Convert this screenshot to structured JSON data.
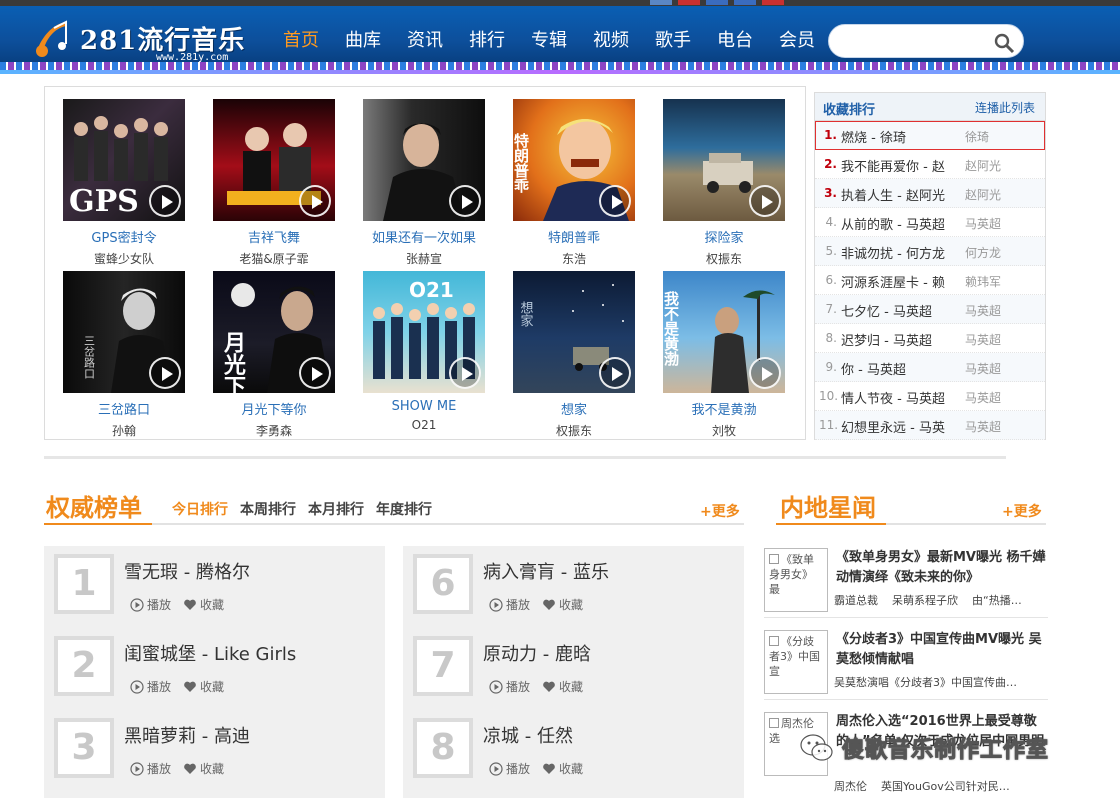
{
  "header": {
    "logo_name": "281流行音乐",
    "logo_url": "www.281y.com",
    "nav": [
      "首页",
      "曲库",
      "资讯",
      "排行",
      "专辑",
      "视频",
      "歌手",
      "电台",
      "会员"
    ],
    "active_nav": "首页",
    "search_placeholder": ""
  },
  "albums": [
    {
      "title": "GPS密封令",
      "singer": "蜜蜂少女队",
      "cover_text": "GPS"
    },
    {
      "title": "吉祥飞舞",
      "singer": "老猫&原子霏",
      "cover_text": ""
    },
    {
      "title": "如果还有一次如果",
      "singer": "张赫宣",
      "cover_text": ""
    },
    {
      "title": "特朗普乖",
      "singer": "东浩",
      "cover_text": "特朗普乖"
    },
    {
      "title": "探险家",
      "singer": "权振东",
      "cover_text": ""
    },
    {
      "title": "三岔路口",
      "singer": "孙翰",
      "cover_text": "三岔路口"
    },
    {
      "title": "月光下等你",
      "singer": "李勇森",
      "cover_text": "月光下"
    },
    {
      "title": "SHOW ME",
      "singer": "O21",
      "cover_text": "O21"
    },
    {
      "title": "想家",
      "singer": "权振东",
      "cover_text": "想家"
    },
    {
      "title": "我不是黄渤",
      "singer": "刘牧",
      "cover_text": "我不是黄渤"
    }
  ],
  "favorites": {
    "title": "收藏排行",
    "play_all": "连播此列表",
    "items": [
      {
        "n": "1.",
        "song": "燃烧 - 徐琦",
        "artist": "徐琦"
      },
      {
        "n": "2.",
        "song": "我不能再爱你 - 赵",
        "artist": "赵阿光"
      },
      {
        "n": "3.",
        "song": "执着人生 - 赵阿光",
        "artist": "赵阿光"
      },
      {
        "n": "4.",
        "song": "从前的歌 - 马英超",
        "artist": "马英超"
      },
      {
        "n": "5.",
        "song": "非诚勿扰 - 何方龙",
        "artist": "何方龙"
      },
      {
        "n": "6.",
        "song": "河源系涯屋卡 - 赖",
        "artist": "赖玮军"
      },
      {
        "n": "7.",
        "song": "七夕忆 - 马英超",
        "artist": "马英超"
      },
      {
        "n": "8.",
        "song": "迟梦归 - 马英超",
        "artist": "马英超"
      },
      {
        "n": "9.",
        "song": "你 - 马英超",
        "artist": "马英超"
      },
      {
        "n": "10.",
        "song": "情人节夜 - 马英超",
        "artist": "马英超"
      },
      {
        "n": "11.",
        "song": "幻想里永远 - 马英",
        "artist": "马英超"
      }
    ]
  },
  "charts": {
    "title": "权威榜单",
    "tabs": [
      "今日排行",
      "本周排行",
      "本月排行",
      "年度排行"
    ],
    "more": "+更多",
    "play_label": "播放",
    "fav_label": "收藏",
    "left": [
      {
        "num": "1",
        "song": "雪无瑕 - 腾格尔"
      },
      {
        "num": "2",
        "song": "闺蜜城堡 - Like Girls"
      },
      {
        "num": "3",
        "song": "黑暗萝莉 - 高迪"
      }
    ],
    "right": [
      {
        "num": "6",
        "song": "病入膏肓 - 蓝乐"
      },
      {
        "num": "7",
        "song": "原动力 - 鹿晗"
      },
      {
        "num": "8",
        "song": "凉城 - 任然"
      }
    ]
  },
  "news": {
    "title": "内地星闻",
    "more": "+更多",
    "items": [
      {
        "thumb": "《致单身男女》最",
        "headline": "《致单身男女》最新MV曝光 杨千嬅动情演绎《致未来的你》",
        "meta": [
          "霸道总裁",
          "呆萌系程子欣",
          "由“热播…"
        ]
      },
      {
        "thumb": "《分歧者3》中国宣",
        "headline": "《分歧者3》中国宣传曲MV曝光 吴莫愁倾情献唱",
        "meta": [
          "吴莫愁演唱《分歧者3》中国宣传曲…"
        ]
      },
      {
        "thumb": "周杰伦选",
        "headline": "周杰伦入选“2016世界上最受尊敬的人”名单 仅次于成龙位居中国男明星第二位",
        "meta": [
          "周杰伦",
          "英国YouGov公司针对民…"
        ]
      }
    ]
  },
  "watermark": "傻歌音乐制作工作室",
  "colors": {
    "accent": "#f08a1c",
    "header_blue": "#0d4f9b",
    "link_blue": "#2a6fb7",
    "rank_red": "#c0000c"
  }
}
